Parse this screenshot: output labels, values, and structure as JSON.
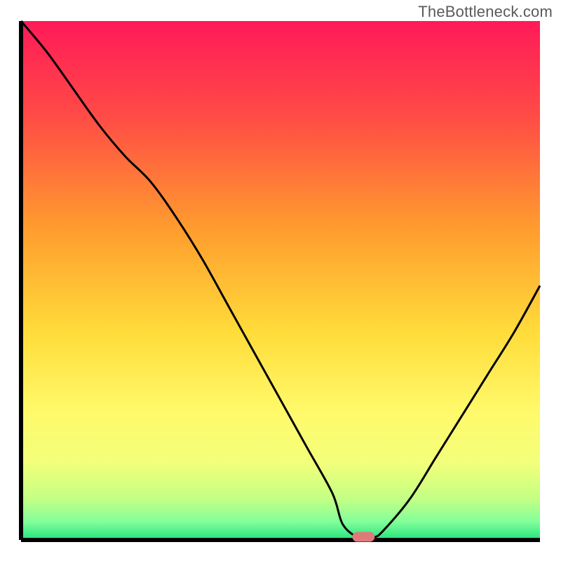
{
  "watermark": "TheBottleneck.com",
  "chart_data": {
    "type": "line",
    "title": "",
    "xlabel": "",
    "ylabel": "",
    "xlim": [
      0,
      100
    ],
    "ylim": [
      0,
      100
    ],
    "background_gradient_stops": [
      {
        "offset": 0,
        "color": "#ff1a58"
      },
      {
        "offset": 0.18,
        "color": "#ff4a46"
      },
      {
        "offset": 0.4,
        "color": "#ff9c2e"
      },
      {
        "offset": 0.6,
        "color": "#ffdc3a"
      },
      {
        "offset": 0.75,
        "color": "#fff96a"
      },
      {
        "offset": 0.85,
        "color": "#f3ff7a"
      },
      {
        "offset": 0.92,
        "color": "#c4ff84"
      },
      {
        "offset": 0.965,
        "color": "#82ff9a"
      },
      {
        "offset": 1.0,
        "color": "#23e27c"
      }
    ],
    "series": [
      {
        "name": "bottleneck-curve",
        "x": [
          0,
          5,
          10,
          15,
          20,
          25,
          30,
          35,
          40,
          45,
          50,
          55,
          60,
          62,
          65,
          68,
          70,
          75,
          80,
          85,
          90,
          95,
          100
        ],
        "y": [
          100,
          94,
          87,
          80,
          74,
          69,
          62,
          54,
          45,
          36,
          27,
          18,
          9,
          3,
          0.5,
          0.5,
          2,
          8,
          16,
          24,
          32,
          40,
          49
        ]
      }
    ],
    "marker": {
      "x": 66,
      "y": 0.6,
      "color": "#e07a7a"
    },
    "colors": {
      "axis": "#000000",
      "curve": "#000000",
      "marker": "#e07a7a"
    }
  }
}
